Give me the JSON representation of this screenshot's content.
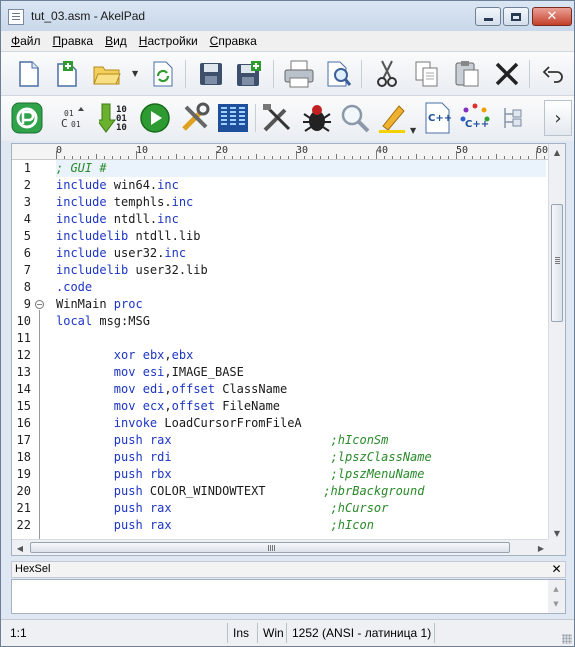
{
  "window": {
    "title": "tut_03.asm - AkelPad",
    "close_glyph": "✕"
  },
  "menu": [
    {
      "label": "Файл",
      "hotkey": "Ф",
      "rest": "айл"
    },
    {
      "label": "Правка",
      "hotkey": "П",
      "rest": "равка"
    },
    {
      "label": "Вид",
      "hotkey": "В",
      "rest": "ид"
    },
    {
      "label": "Настройки",
      "hotkey": "Н",
      "rest": "астройки"
    },
    {
      "label": "Справка",
      "hotkey": "С",
      "rest": "правка"
    }
  ],
  "toolbar1": [
    "new-file-icon",
    "new-tab-icon",
    "open-folder-icon",
    "reopen-icon",
    "save-icon",
    "save-all-icon",
    "print-icon",
    "print-preview-icon",
    "cut-icon",
    "copy-icon",
    "paste-icon",
    "delete-icon",
    "undo-icon"
  ],
  "toolbar2": [
    "akelpad-logo-icon",
    "codepage-icon",
    "binary-icon",
    "run-icon",
    "settings-tools-icon",
    "columns-icon",
    "tools-icon",
    "debug-bug-icon",
    "find-icon",
    "highlight-pen-icon",
    "cpp-file-icon",
    "cpp-color-icon",
    "tree-icon",
    "more-icon"
  ],
  "ruler": {
    "labels": [
      "0",
      "10",
      "20",
      "30",
      "40",
      "50",
      "60"
    ]
  },
  "editor": {
    "lines": [
      {
        "n": "1",
        "segments": [
          {
            "t": "; GUI #",
            "c": "cm"
          }
        ]
      },
      {
        "n": "2",
        "segments": [
          {
            "t": "include",
            "c": "kw"
          },
          {
            "t": " win64."
          },
          {
            "t": "inc",
            "c": "kw"
          }
        ]
      },
      {
        "n": "3",
        "segments": [
          {
            "t": "include",
            "c": "kw"
          },
          {
            "t": " temphls."
          },
          {
            "t": "inc",
            "c": "kw"
          }
        ]
      },
      {
        "n": "4",
        "segments": [
          {
            "t": "include",
            "c": "kw"
          },
          {
            "t": " ntdll."
          },
          {
            "t": "inc",
            "c": "kw"
          }
        ]
      },
      {
        "n": "5",
        "segments": [
          {
            "t": "includelib",
            "c": "kw"
          },
          {
            "t": " ntdll.lib"
          }
        ]
      },
      {
        "n": "6",
        "segments": [
          {
            "t": "include",
            "c": "kw"
          },
          {
            "t": " user32."
          },
          {
            "t": "inc",
            "c": "kw"
          }
        ]
      },
      {
        "n": "7",
        "segments": [
          {
            "t": "includelib",
            "c": "kw"
          },
          {
            "t": " user32.lib"
          }
        ]
      },
      {
        "n": "8",
        "segments": [
          {
            "t": ".code",
            "c": "kw"
          }
        ]
      },
      {
        "n": "9",
        "segments": [
          {
            "t": "WinMain "
          },
          {
            "t": "proc",
            "c": "kw"
          }
        ]
      },
      {
        "n": "10",
        "segments": [
          {
            "t": "local",
            "c": "kw"
          },
          {
            "t": " msg:MSG"
          }
        ]
      },
      {
        "n": "11",
        "segments": []
      },
      {
        "n": "12",
        "segments": [
          {
            "t": "        "
          },
          {
            "t": "xor",
            "c": "kw"
          },
          {
            "t": " "
          },
          {
            "t": "ebx",
            "c": "kw"
          },
          {
            "t": ","
          },
          {
            "t": "ebx",
            "c": "kw"
          }
        ]
      },
      {
        "n": "13",
        "segments": [
          {
            "t": "        "
          },
          {
            "t": "mov",
            "c": "kw"
          },
          {
            "t": " "
          },
          {
            "t": "esi",
            "c": "kw"
          },
          {
            "t": ",IMAGE_BASE"
          }
        ]
      },
      {
        "n": "14",
        "segments": [
          {
            "t": "        "
          },
          {
            "t": "mov",
            "c": "kw"
          },
          {
            "t": " "
          },
          {
            "t": "edi",
            "c": "kw"
          },
          {
            "t": ","
          },
          {
            "t": "offset",
            "c": "kw"
          },
          {
            "t": " ClassName"
          }
        ]
      },
      {
        "n": "15",
        "segments": [
          {
            "t": "        "
          },
          {
            "t": "mov",
            "c": "kw"
          },
          {
            "t": " "
          },
          {
            "t": "ecx",
            "c": "kw"
          },
          {
            "t": ","
          },
          {
            "t": "offset",
            "c": "kw"
          },
          {
            "t": " FileName"
          }
        ]
      },
      {
        "n": "16",
        "segments": [
          {
            "t": "        "
          },
          {
            "t": "invoke",
            "c": "kw"
          },
          {
            "t": " LoadCursorFromFileA"
          }
        ]
      },
      {
        "n": "17",
        "segments": [
          {
            "t": "        "
          },
          {
            "t": "push",
            "c": "kw"
          },
          {
            "t": " "
          },
          {
            "t": "rax",
            "c": "kw"
          },
          {
            "t": "                      "
          },
          {
            "t": ";hIconSm",
            "c": "cm"
          }
        ]
      },
      {
        "n": "18",
        "segments": [
          {
            "t": "        "
          },
          {
            "t": "push",
            "c": "kw"
          },
          {
            "t": " "
          },
          {
            "t": "rdi",
            "c": "kw"
          },
          {
            "t": "                      "
          },
          {
            "t": ";lpszClassName",
            "c": "cm"
          }
        ]
      },
      {
        "n": "19",
        "segments": [
          {
            "t": "        "
          },
          {
            "t": "push",
            "c": "kw"
          },
          {
            "t": " "
          },
          {
            "t": "rbx",
            "c": "kw"
          },
          {
            "t": "                      "
          },
          {
            "t": ";lpszMenuName",
            "c": "cm"
          }
        ]
      },
      {
        "n": "20",
        "segments": [
          {
            "t": "        "
          },
          {
            "t": "push",
            "c": "kw"
          },
          {
            "t": " COLOR_WINDOWTEXT        "
          },
          {
            "t": ";hbrBackground",
            "c": "cm"
          }
        ]
      },
      {
        "n": "21",
        "segments": [
          {
            "t": "        "
          },
          {
            "t": "push",
            "c": "kw"
          },
          {
            "t": " "
          },
          {
            "t": "rax",
            "c": "kw"
          },
          {
            "t": "                      "
          },
          {
            "t": ";hCursor",
            "c": "cm"
          }
        ]
      },
      {
        "n": "22",
        "segments": [
          {
            "t": "        "
          },
          {
            "t": "push",
            "c": "kw"
          },
          {
            "t": " "
          },
          {
            "t": "rax",
            "c": "kw"
          },
          {
            "t": "                      "
          },
          {
            "t": ";hIcon",
            "c": "cm"
          }
        ]
      }
    ]
  },
  "colors": {
    "keyword": "#1d35c4",
    "comment": "#2a8a2a",
    "current_line": "#eaf2fb"
  },
  "panel": {
    "title": "HexSel",
    "close_glyph": "✕",
    "content": ""
  },
  "status": {
    "position": "1:1",
    "insert_mode": "Ins",
    "newline": "Win",
    "codepage": "1252  (ANSI - латиница 1)"
  }
}
